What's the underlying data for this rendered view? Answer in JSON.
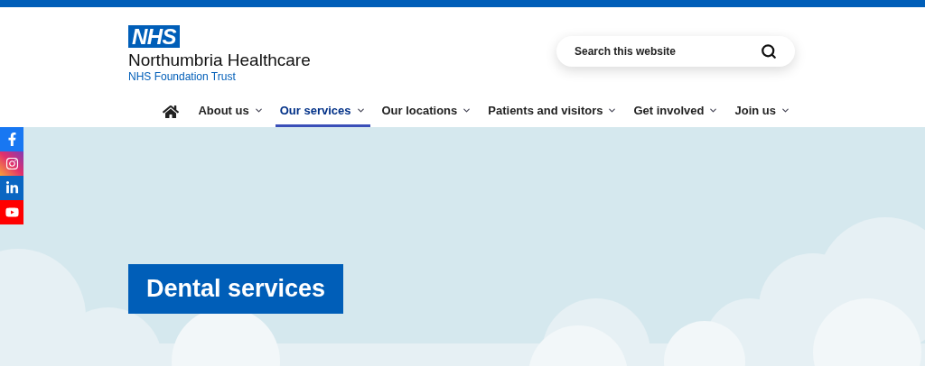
{
  "logo": {
    "badge": "NHS",
    "name": "Northumbria Healthcare",
    "subtitle": "NHS Foundation Trust"
  },
  "search": {
    "placeholder": "Search this website"
  },
  "nav": [
    {
      "label": "About us",
      "selected": false
    },
    {
      "label": "Our services",
      "selected": true
    },
    {
      "label": "Our locations",
      "selected": false
    },
    {
      "label": "Patients and visitors",
      "selected": false
    },
    {
      "label": "Get involved",
      "selected": false
    },
    {
      "label": "Join us",
      "selected": false
    }
  ],
  "social": [
    {
      "kind": "facebook"
    },
    {
      "kind": "instagram"
    },
    {
      "kind": "linkedin"
    },
    {
      "kind": "youtube"
    }
  ],
  "hero": {
    "title": "Dental services"
  }
}
